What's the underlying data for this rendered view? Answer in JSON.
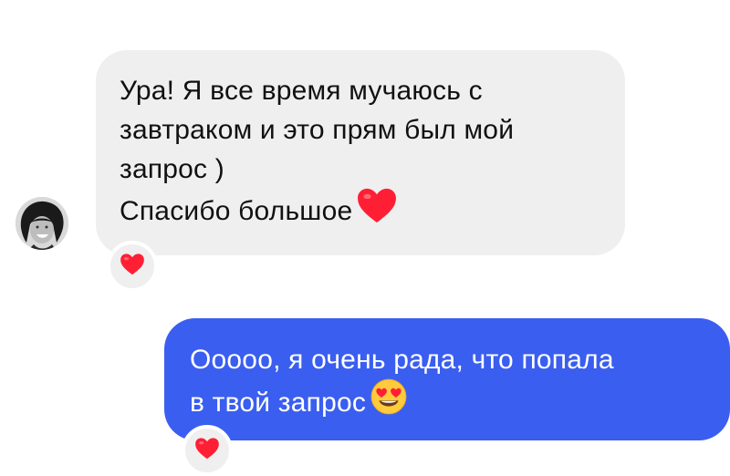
{
  "conversation": {
    "incoming": {
      "lines": [
        "Ура! Я все время мучаюсь с",
        "завтраком и это прям был мой",
        "запрос )",
        "Спасибо большое"
      ],
      "trailing_icon": "red-heart-emoji",
      "reaction_icon": "red-heart-emoji"
    },
    "outgoing": {
      "lines": [
        "Ооооо, я очень рада, что попала",
        "в твой запрос"
      ],
      "trailing_icon": "heart-eyes-emoji",
      "reaction_icon": "red-heart-emoji"
    }
  },
  "colors": {
    "incoming_bubble": "#efefef",
    "outgoing_bubble": "#3a5ef0",
    "heart": "#ff1f35",
    "text_dark": "#111111",
    "text_light": "#ffffff"
  }
}
